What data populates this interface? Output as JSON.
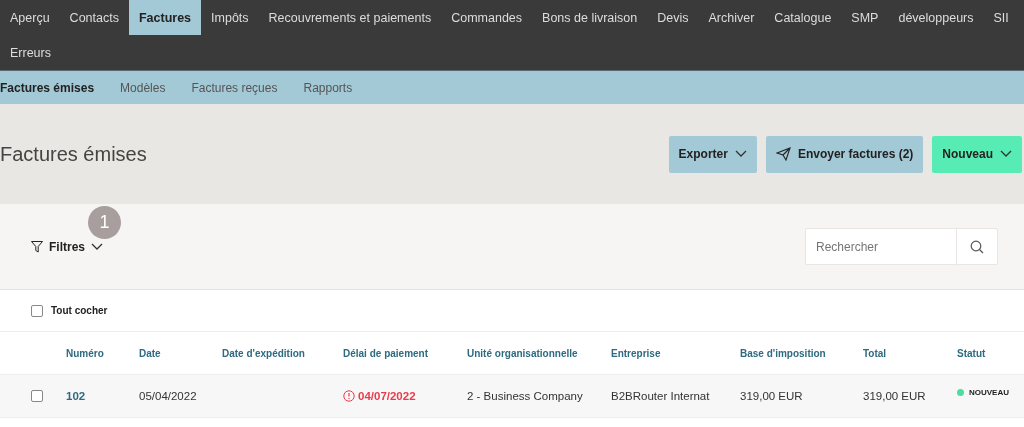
{
  "main_nav": [
    {
      "label": "Aperçu",
      "selected": false
    },
    {
      "label": "Contacts",
      "selected": false
    },
    {
      "label": "Factures",
      "selected": true
    },
    {
      "label": "Impôts",
      "selected": false
    },
    {
      "label": "Recouvrements et paiements",
      "selected": false
    },
    {
      "label": "Commandes",
      "selected": false
    },
    {
      "label": "Bons de livraison",
      "selected": false
    },
    {
      "label": "Devis",
      "selected": false
    },
    {
      "label": "Archiver",
      "selected": false
    },
    {
      "label": "Catalogue",
      "selected": false
    },
    {
      "label": "SMP",
      "selected": false
    },
    {
      "label": "développeurs",
      "selected": false
    },
    {
      "label": "SII",
      "selected": false
    },
    {
      "label": "Erreurs",
      "selected": false
    }
  ],
  "sub_nav": [
    {
      "label": "Factures émises",
      "selected": true
    },
    {
      "label": "Modèles",
      "selected": false
    },
    {
      "label": "Factures reçues",
      "selected": false
    },
    {
      "label": "Rapports",
      "selected": false
    }
  ],
  "page_title": "Factures émises",
  "actions": [
    {
      "label": "Exporter",
      "kind": "dropdown"
    },
    {
      "label": "Envoyer factures (2)",
      "kind": "send"
    },
    {
      "label": "Nouveau",
      "kind": "primary-dropdown"
    }
  ],
  "filters": {
    "label": "Filtres",
    "step_marker": "1"
  },
  "search": {
    "placeholder": "Rechercher"
  },
  "select_all": {
    "label": "Tout cocher",
    "checked": false
  },
  "table": {
    "columns": [
      "Numéro",
      "Date",
      "Date d'expédition",
      "Délai de paiement",
      "Unité organisationnelle",
      "Entreprise",
      "Base d'imposition",
      "Total",
      "Statut"
    ],
    "rows": [
      {
        "checked": false,
        "number": "102",
        "date": "05/04/2022",
        "due_date": "04/07/2022",
        "overdue": true,
        "unit": "2 - Business Company",
        "company": "B2BRouter Internat",
        "tax_base": "319,00 EUR",
        "total": "319,00 EUR",
        "status": "NOUVEAU",
        "color": "#4fdca0"
      }
    ]
  }
}
